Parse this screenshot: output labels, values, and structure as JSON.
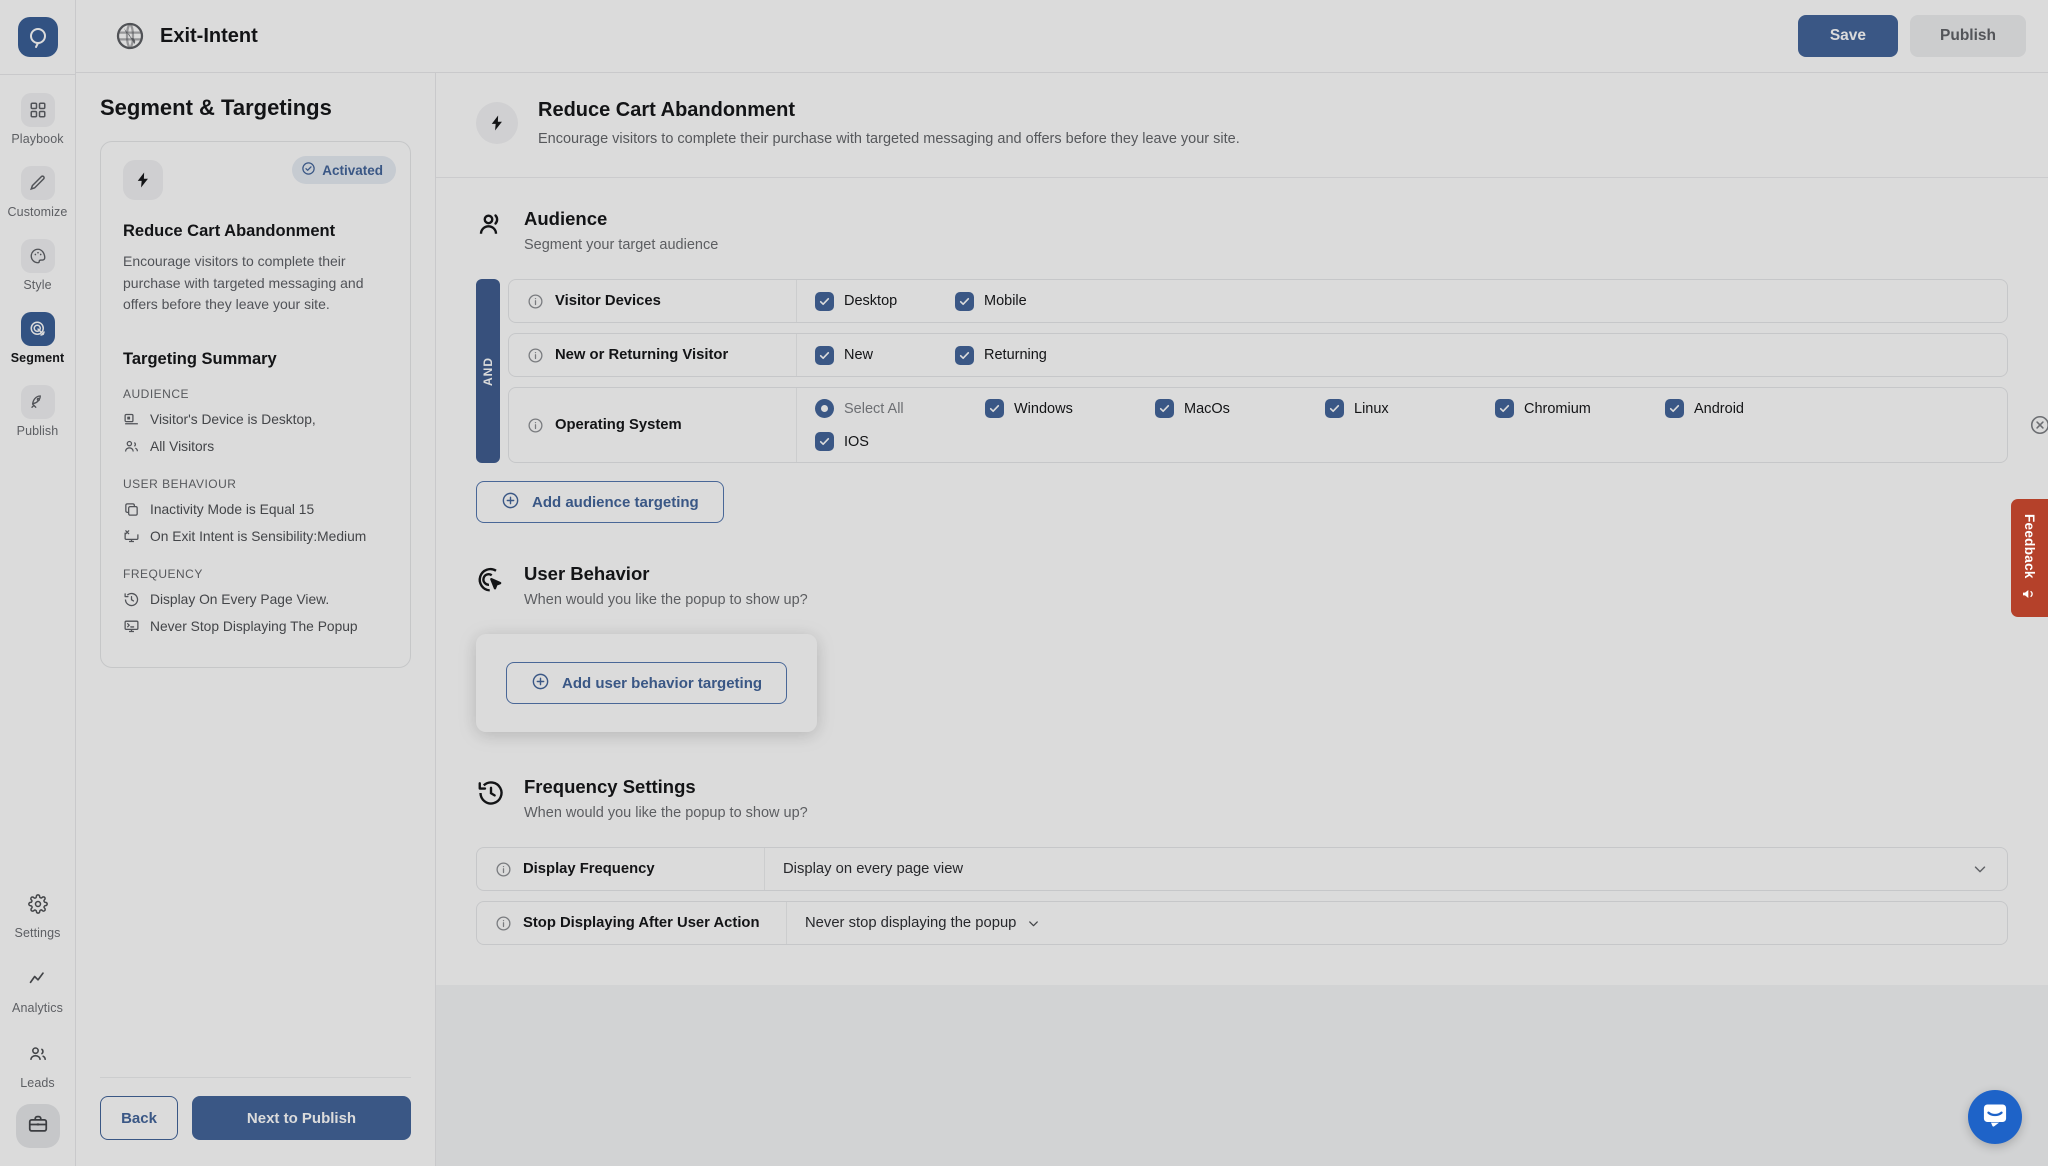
{
  "app": {
    "logo_icon": "opsin-logo-icon"
  },
  "topbar": {
    "globe_icon": "globe-icon",
    "doc_title": "Exit-Intent",
    "save_label": "Save",
    "publish_label": "Publish"
  },
  "sidebar": {
    "items": [
      {
        "label": "Playbook",
        "icon": "grid-icon",
        "active": false
      },
      {
        "label": "Customize",
        "icon": "pencil-icon",
        "active": false
      },
      {
        "label": "Style",
        "icon": "palette-icon",
        "active": false
      },
      {
        "label": "Segment",
        "icon": "target-icon",
        "active": true
      },
      {
        "label": "Publish",
        "icon": "rocket-icon",
        "active": false
      }
    ],
    "bottom_items": [
      {
        "label": "Settings",
        "icon": "gear-icon"
      },
      {
        "label": "Analytics",
        "icon": "chart-line-icon"
      },
      {
        "label": "Leads",
        "icon": "users-icon"
      }
    ],
    "workspace_icon": "briefcase-icon"
  },
  "left_panel": {
    "title": "Segment & Targetings",
    "card": {
      "status_badge": "Activated",
      "status_icon": "check-circle-icon",
      "bolt_icon": "bolt-icon",
      "heading": "Reduce Cart Abandonment",
      "description": "Encourage visitors to complete their purchase with targeted messaging and offers before they leave your site."
    },
    "summary_title": "Targeting Summary",
    "groups": [
      {
        "label": "AUDIENCE",
        "rows": [
          {
            "icon": "device-icon",
            "text": "Visitor's Device is Desktop,"
          },
          {
            "icon": "users-icon",
            "text": "All Visitors"
          }
        ]
      },
      {
        "label": "USER BEHAVIOUR",
        "rows": [
          {
            "icon": "copy-icon",
            "text": "Inactivity Mode is Equal 15"
          },
          {
            "icon": "exit-monitor-icon",
            "text": "On Exit Intent is Sensibility:Medium"
          }
        ]
      },
      {
        "label": "FREQUENCY",
        "rows": [
          {
            "icon": "history-icon",
            "text": "Display On Every Page View."
          },
          {
            "icon": "monitor-stop-icon",
            "text": "Never Stop Displaying The Popup"
          }
        ]
      }
    ],
    "back_label": "Back",
    "next_label": "Next to Publish"
  },
  "main": {
    "header": {
      "bolt_icon": "bolt-icon",
      "title": "Reduce Cart Abandonment",
      "subtitle": "Encourage visitors to complete their purchase with targeted messaging and offers before they leave your site."
    },
    "audience": {
      "icon": "audience-icon",
      "title": "Audience",
      "subtitle": "Segment your target audience",
      "and_label": "AND",
      "remove_icon": "remove-circle-icon",
      "rules": [
        {
          "label": "Visitor Devices",
          "info_icon": "info-icon",
          "options": [
            {
              "type": "checkbox",
              "label": "Desktop",
              "checked": true
            },
            {
              "type": "checkbox",
              "label": "Mobile",
              "checked": true
            }
          ]
        },
        {
          "label": "New or Returning Visitor",
          "info_icon": "info-icon",
          "options": [
            {
              "type": "checkbox",
              "label": "New",
              "checked": true
            },
            {
              "type": "checkbox",
              "label": "Returning",
              "checked": true
            }
          ]
        },
        {
          "label": "Operating System",
          "info_icon": "info-icon",
          "options": [
            {
              "type": "radio",
              "label": "Select All",
              "checked": true,
              "muted": true
            },
            {
              "type": "checkbox",
              "label": "Windows",
              "checked": true
            },
            {
              "type": "checkbox",
              "label": "MacOs",
              "checked": true
            },
            {
              "type": "checkbox",
              "label": "Linux",
              "checked": true
            },
            {
              "type": "checkbox",
              "label": "Chromium",
              "checked": true
            },
            {
              "type": "checkbox",
              "label": "Android",
              "checked": true
            },
            {
              "type": "checkbox",
              "label": "IOS",
              "checked": true
            }
          ]
        }
      ],
      "add_label": "Add audience targeting",
      "add_icon": "plus-circle-icon"
    },
    "user_behavior": {
      "icon": "cursor-target-icon",
      "title": "User Behavior",
      "subtitle": "When would you like the popup to show up?",
      "add_label": "Add user behavior targeting",
      "add_icon": "plus-circle-icon"
    },
    "frequency": {
      "icon": "history-icon",
      "title": "Frequency Settings",
      "subtitle": "When would you like the popup to show up?",
      "rows": [
        {
          "label": "Display Frequency",
          "info_icon": "info-icon",
          "value": "Display on every page view",
          "chevron": "chevron-down-icon",
          "chevron_position": "far-right"
        },
        {
          "label": "Stop Displaying After User Action",
          "info_icon": "info-icon",
          "value": "Never stop displaying the popup",
          "chevron": "chevron-down-icon",
          "chevron_position": "inline"
        }
      ]
    }
  },
  "feedback_tab": {
    "label": "Feedback",
    "icon": "megaphone-icon"
  },
  "intercom": {
    "icon": "messenger-icon"
  },
  "colors": {
    "accent": "#2a68c9",
    "and_bar": "#2a5fbd",
    "feedback": "#b5412a",
    "badge_bg": "#e3ecfa"
  }
}
